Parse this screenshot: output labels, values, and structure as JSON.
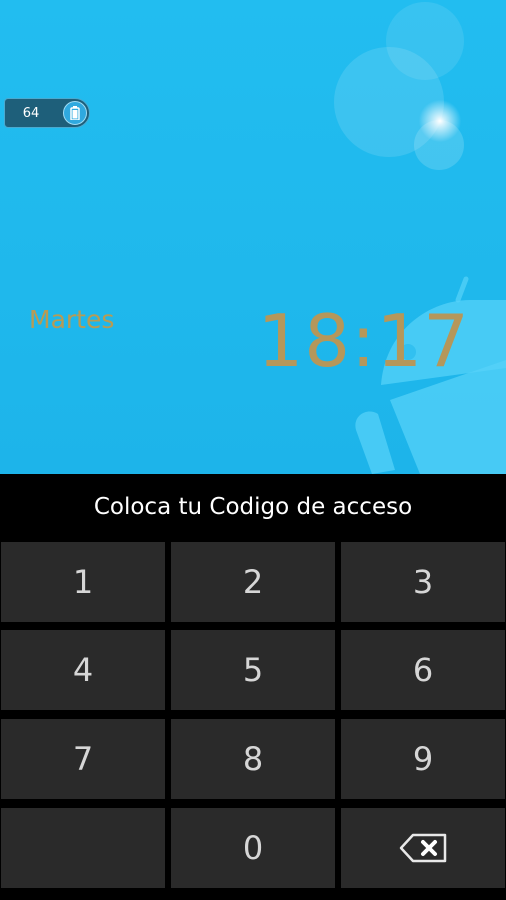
{
  "lockscreen": {
    "battery": {
      "level": "64",
      "icon": "battery-icon"
    },
    "day": "Martes",
    "time": "18:17",
    "wallpaper": {
      "accent": "#1fb8ec",
      "mascot": "android-robot"
    },
    "text_color": "#b5975a"
  },
  "pin_entry": {
    "prompt": "Coloca tu Codigo de acceso",
    "keys": [
      {
        "label": "1"
      },
      {
        "label": "2"
      },
      {
        "label": "3"
      },
      {
        "label": "4"
      },
      {
        "label": "5"
      },
      {
        "label": "6"
      },
      {
        "label": "7"
      },
      {
        "label": "8"
      },
      {
        "label": "9"
      },
      {
        "label": ""
      },
      {
        "label": "0"
      },
      {
        "icon": "backspace-icon"
      }
    ]
  }
}
